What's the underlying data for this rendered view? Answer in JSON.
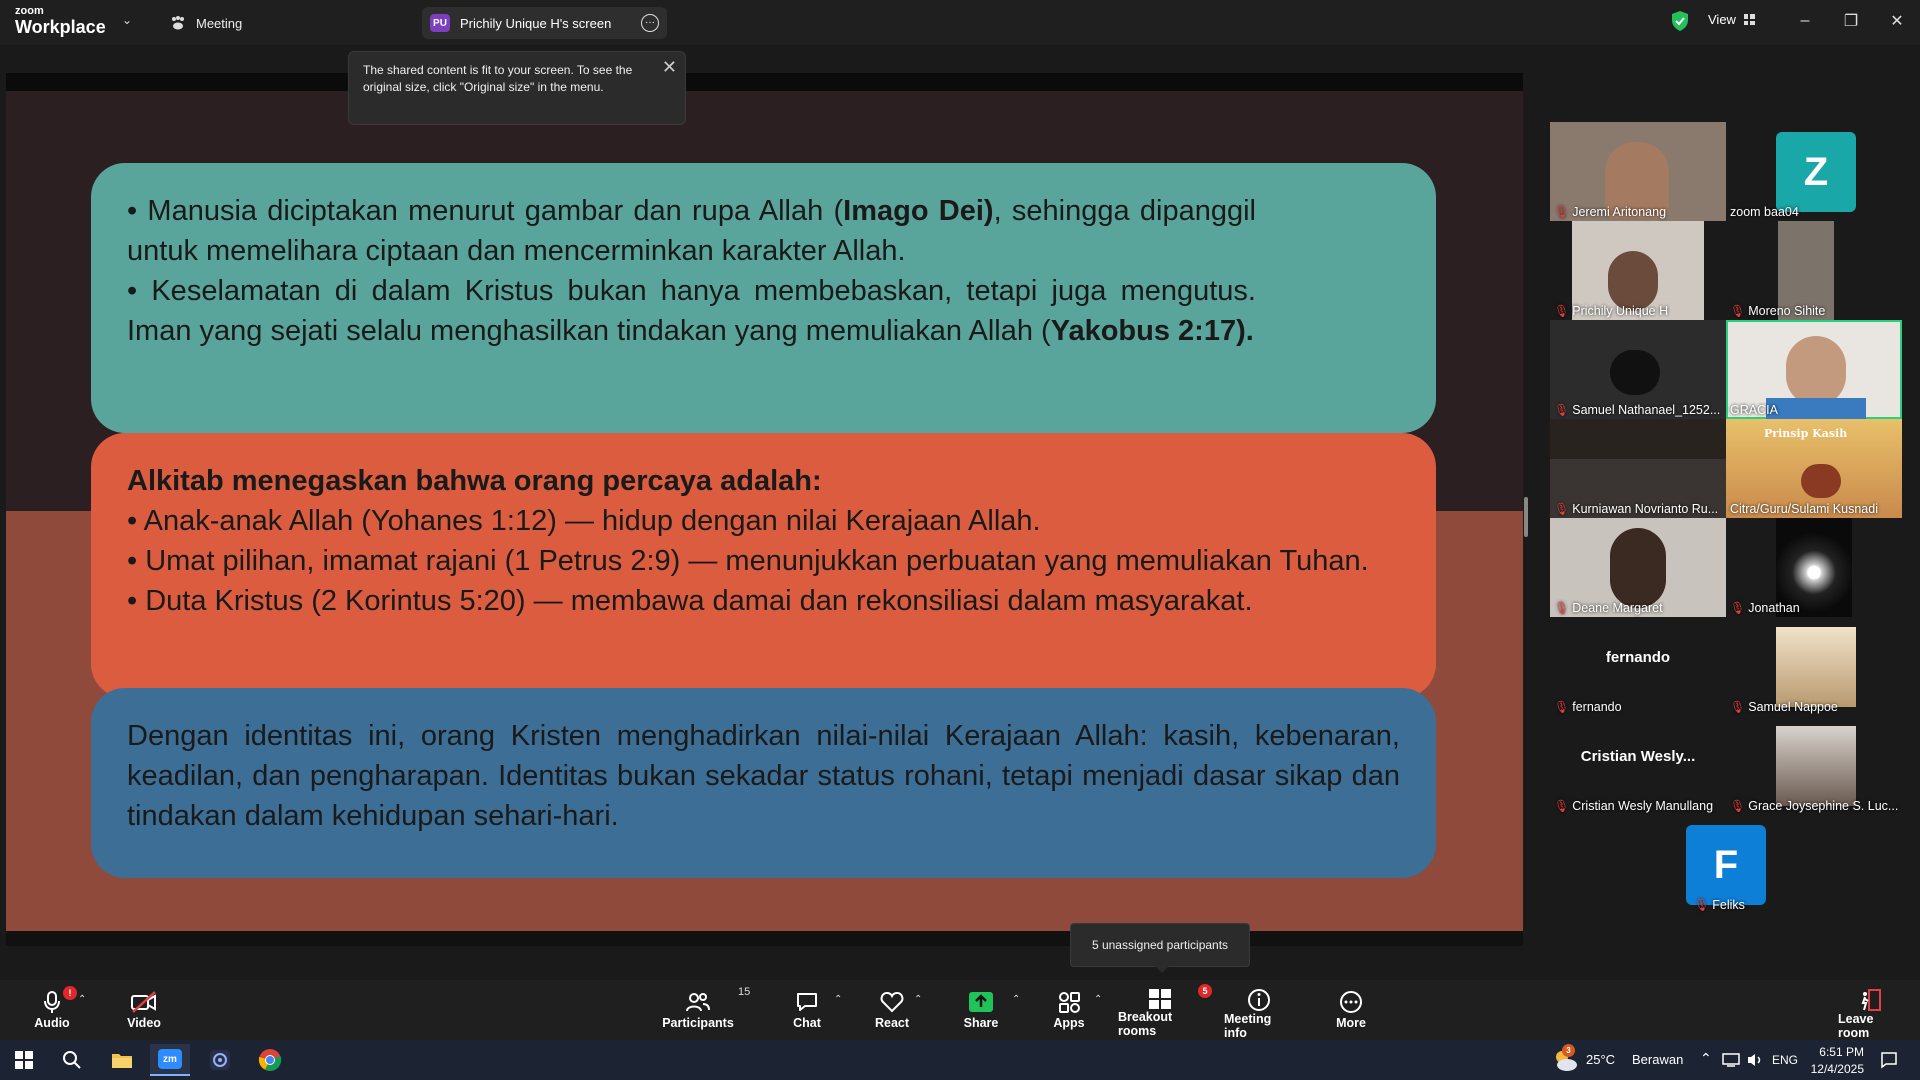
{
  "titlebar": {
    "brand_small": "zoom",
    "brand_big": "Workplace",
    "meeting_label": "Meeting",
    "share_badge": "PU",
    "share_label": "Prichily Unique H's screen",
    "view_label": "View"
  },
  "tooltip": {
    "text": "The shared content is fit to your screen. To see the original size, click \"Original size\" in the menu."
  },
  "slide": {
    "panel1": {
      "b1_pre": "• Manusia diciptakan menurut gambar dan rupa Allah (",
      "b1_bold": "Imago Dei)",
      "b1_post": ", sehingga dipanggil untuk memelihara ciptaan dan mencerminkan karakter Allah.",
      "b2_pre": "• Keselamatan di dalam Kristus bukan hanya membebaskan, tetapi juga mengutus. Iman yang sejati selalu menghasilkan tindakan yang memuliakan Allah (",
      "b2_bold": "Yakobus 2:17)."
    },
    "panel2": {
      "heading": "Alkitab menegaskan bahwa orang percaya adalah:",
      "items": [
        "• Anak-anak Allah (Yohanes 1:12) — hidup dengan nilai Kerajaan Allah.",
        "• Umat pilihan, imamat rajani (1 Petrus 2:9) — menunjukkan perbuatan yang memuliakan Tuhan.",
        "• Duta Kristus (2 Korintus 5:20) — membawa damai dan rekonsiliasi dalam masyarakat."
      ]
    },
    "panel3": {
      "text": "Dengan identitas ini, orang Kristen menghadirkan nilai-nilai Kerajaan Allah: kasih, kebenaran, keadilan, dan pengharapan. Identitas bukan sekadar status rohani, tetapi menjadi dasar sikap dan tindakan dalam kehidupan sehari-hari."
    }
  },
  "gallery": {
    "participants": [
      {
        "name": "Jeremi Aritonang"
      },
      {
        "name": "zoom baa04",
        "letter": "Z"
      },
      {
        "name": "Prichily Unique H"
      },
      {
        "name": "Moreno Sihite"
      },
      {
        "name": "Samuel Nathanael_1252..."
      },
      {
        "name": "GRACIA"
      },
      {
        "name": "Kurniawan Novrianto Ru..."
      },
      {
        "name": "Citra/Guru/Sulami Kusnadi",
        "image_text": "Prinsip Kasih"
      },
      {
        "name": "Deane Margaret"
      },
      {
        "name": "Jonathan"
      },
      {
        "name": "fernando",
        "center": "fernando"
      },
      {
        "name": "Samuel Nappoe"
      },
      {
        "name": "Cristian Wesly Manullang",
        "center": "Cristian Wesly..."
      },
      {
        "name": "Grace Joysephine S. Luc..."
      },
      {
        "name": "Feliks",
        "letter": "F"
      }
    ]
  },
  "breakout_tip": "5 unassigned participants",
  "toolbar": {
    "audio": "Audio",
    "audio_badge": "!",
    "video": "Video",
    "participants": "Participants",
    "participants_count": "15",
    "chat": "Chat",
    "react": "React",
    "share": "Share",
    "apps": "Apps",
    "breakout": "Breakout rooms",
    "breakout_badge": "5",
    "meeting_info": "Meeting info",
    "more": "More",
    "leave": "Leave room"
  },
  "taskbar": {
    "zoom_icon": "zm",
    "weather_temp": "25°C",
    "weather_desc": "Berawan",
    "weather_badge": "3",
    "lang": "ENG",
    "time": "6:51 PM",
    "date": "12/4/2025"
  },
  "colors": {
    "panel1": "#5aa59b",
    "panel2": "#db5c3f",
    "panel3": "#3c6e96",
    "share_green": "#1fc35a",
    "active_border": "#26d07c",
    "mute_red": "#e24040"
  }
}
